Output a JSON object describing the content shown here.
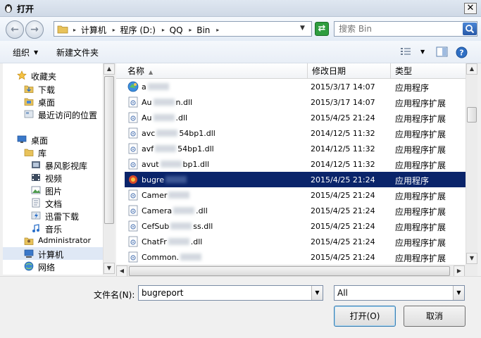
{
  "window": {
    "title": "打开",
    "close_label": "✕"
  },
  "nav": {
    "back_label": "←",
    "forward_label": "→",
    "breadcrumb": [
      "计算机",
      "程序 (D:)",
      "QQ",
      "Bin"
    ],
    "refresh_label": "⇄",
    "search_placeholder": "搜索 Bin"
  },
  "toolbar": {
    "organize": "组织",
    "new_folder": "新建文件夹"
  },
  "sidebar": {
    "items": [
      {
        "label": "收藏夹",
        "icon": "star-icon"
      },
      {
        "label": "下载",
        "icon": "download-folder-icon"
      },
      {
        "label": "桌面",
        "icon": "desktop-folder-icon"
      },
      {
        "label": "最近访问的位置",
        "icon": "recent-places-icon"
      },
      {
        "label": "桌面",
        "icon": "desktop-icon"
      },
      {
        "label": "库",
        "icon": "library-icon"
      },
      {
        "label": "暴风影视库",
        "icon": "video-library-icon"
      },
      {
        "label": "视频",
        "icon": "video-icon"
      },
      {
        "label": "图片",
        "icon": "pictures-icon"
      },
      {
        "label": "文档",
        "icon": "documents-icon"
      },
      {
        "label": "迅雷下载",
        "icon": "thunder-download-icon"
      },
      {
        "label": "音乐",
        "icon": "music-icon"
      },
      {
        "label": "Administrator",
        "icon": "user-folder-icon"
      },
      {
        "label": "计算机",
        "icon": "computer-icon"
      },
      {
        "label": "网络",
        "icon": "network-icon"
      }
    ]
  },
  "files": {
    "columns": {
      "name": "名称",
      "date": "修改日期",
      "type": "类型"
    },
    "rows": [
      {
        "name_a": "a",
        "name_b": "",
        "date": "2015/3/17 14:07",
        "type": "应用程序",
        "icon": "app-icon"
      },
      {
        "name_a": "Au",
        "name_b": "n.dll",
        "date": "2015/3/17 14:07",
        "type": "应用程序扩展",
        "icon": "dll-icon"
      },
      {
        "name_a": "Au",
        "name_b": ".dll",
        "date": "2015/4/25 21:24",
        "type": "应用程序扩展",
        "icon": "dll-icon"
      },
      {
        "name_a": "avc",
        "name_b": "54bp1.dll",
        "date": "2014/12/5 11:32",
        "type": "应用程序扩展",
        "icon": "dll-icon"
      },
      {
        "name_a": "avf",
        "name_b": "54bp1.dll",
        "date": "2014/12/5 11:32",
        "type": "应用程序扩展",
        "icon": "dll-icon"
      },
      {
        "name_a": "avut",
        "name_b": "bp1.dll",
        "date": "2014/12/5 11:32",
        "type": "应用程序扩展",
        "icon": "dll-icon"
      },
      {
        "name_a": "bugre",
        "name_b": "",
        "date": "2015/4/25 21:24",
        "type": "应用程序",
        "icon": "bugreport-app-icon"
      },
      {
        "name_a": "Camer",
        "name_b": "",
        "date": "2015/4/25 21:24",
        "type": "应用程序扩展",
        "icon": "dll-icon"
      },
      {
        "name_a": "Camera",
        "name_b": ".dll",
        "date": "2015/4/25 21:24",
        "type": "应用程序扩展",
        "icon": "dll-icon"
      },
      {
        "name_a": "CefSub",
        "name_b": "ss.dll",
        "date": "2015/4/25 21:24",
        "type": "应用程序扩展",
        "icon": "dll-icon"
      },
      {
        "name_a": "ChatFr",
        "name_b": ".dll",
        "date": "2015/4/25 21:24",
        "type": "应用程序扩展",
        "icon": "dll-icon"
      },
      {
        "name_a": "Common.",
        "name_b": "",
        "date": "2015/4/25 21:24",
        "type": "应用程序扩展",
        "icon": "dll-icon"
      }
    ]
  },
  "footer": {
    "filename_label": "文件名(N):",
    "filename_value": "bugreport",
    "filetype_value": "All",
    "open_label": "打开(O)",
    "cancel_label": "取消"
  },
  "colors": {
    "selection": "#0a246a",
    "nav_hover": "#dfe8f5"
  }
}
